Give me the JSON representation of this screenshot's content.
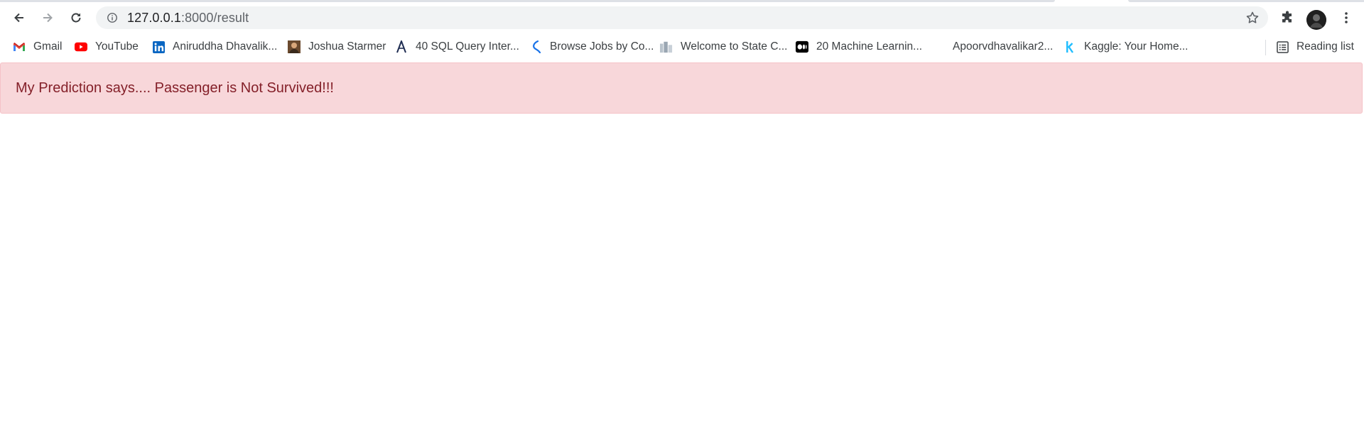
{
  "browser": {
    "url_host": "127.0.0.1",
    "url_path": ":8000/result"
  },
  "bookmarks": [
    {
      "label": "Gmail",
      "icon": "gmail-icon"
    },
    {
      "label": "YouTube",
      "icon": "youtube-icon"
    },
    {
      "label": "Aniruddha Dhavalik...",
      "icon": "linkedin-icon"
    },
    {
      "label": "Joshua Starmer",
      "icon": "profile-photo-icon"
    },
    {
      "label": "40 SQL Query Inter...",
      "icon": "a-logo-icon"
    },
    {
      "label": "Browse Jobs by Co...",
      "icon": "k-curve-icon"
    },
    {
      "label": "Welcome to State C...",
      "icon": "building-icon"
    },
    {
      "label": "20 Machine Learnin...",
      "icon": "medium-icon"
    },
    {
      "label": "Apoorvdhavalikar2...",
      "icon": "blank-icon"
    },
    {
      "label": "Kaggle: Your Home...",
      "icon": "kaggle-icon"
    }
  ],
  "reading_list": {
    "label": "Reading list",
    "icon": "reading-list-icon"
  },
  "alert": {
    "message": "My Prediction says.... Passenger is Not Survived!!!"
  },
  "colors": {
    "alert_bg": "#f8d7da",
    "alert_text": "#842029",
    "omnibox_bg": "#f1f3f4"
  }
}
